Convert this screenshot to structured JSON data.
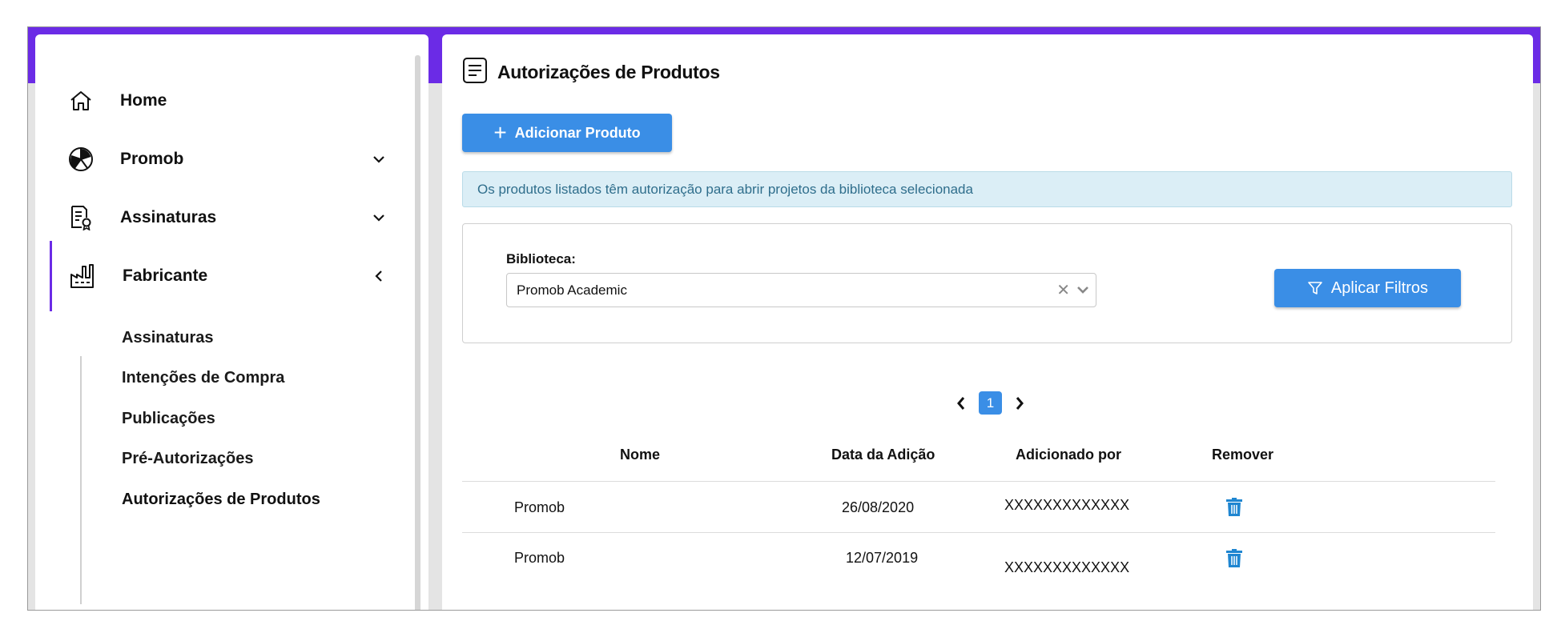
{
  "sidebar": {
    "items": [
      {
        "label": "Home",
        "icon": "home-icon"
      },
      {
        "label": "Promob",
        "icon": "promob-logo-icon"
      },
      {
        "label": "Assinaturas",
        "icon": "document-badge-icon"
      },
      {
        "label": "Fabricante",
        "icon": "factory-icon"
      }
    ],
    "subitems": [
      {
        "label": "Assinaturas"
      },
      {
        "label": "Intenções de Compra"
      },
      {
        "label": "Publicações"
      },
      {
        "label": "Pré-Autorizações"
      },
      {
        "label": "Autorizações de Produtos"
      }
    ]
  },
  "main": {
    "title": "Autorizações de Produtos",
    "add_button": "Adicionar Produto",
    "info_text": "Os produtos listados têm autorização para abrir projetos da biblioteca selecionada",
    "filter": {
      "label": "Biblioteca:",
      "selected": "Promob Academic",
      "apply_button": "Aplicar Filtros"
    },
    "pagination": {
      "current_page": "1"
    },
    "table": {
      "columns": [
        "Nome",
        "Data da Adição",
        "Adicionado por",
        "Remover"
      ],
      "rows": [
        {
          "nome": "Promob",
          "data": "26/08/2020",
          "adicionado_por": "XXXXXXXXXXXXX"
        },
        {
          "nome": "Promob",
          "data": "12/07/2019",
          "adicionado_por": "XXXXXXXXXXXXX"
        }
      ]
    }
  },
  "colors": {
    "accent": "#6b2be6",
    "primary": "#3a8ee6",
    "info_bg": "#dbeef6",
    "info_text": "#2f6e8c"
  }
}
